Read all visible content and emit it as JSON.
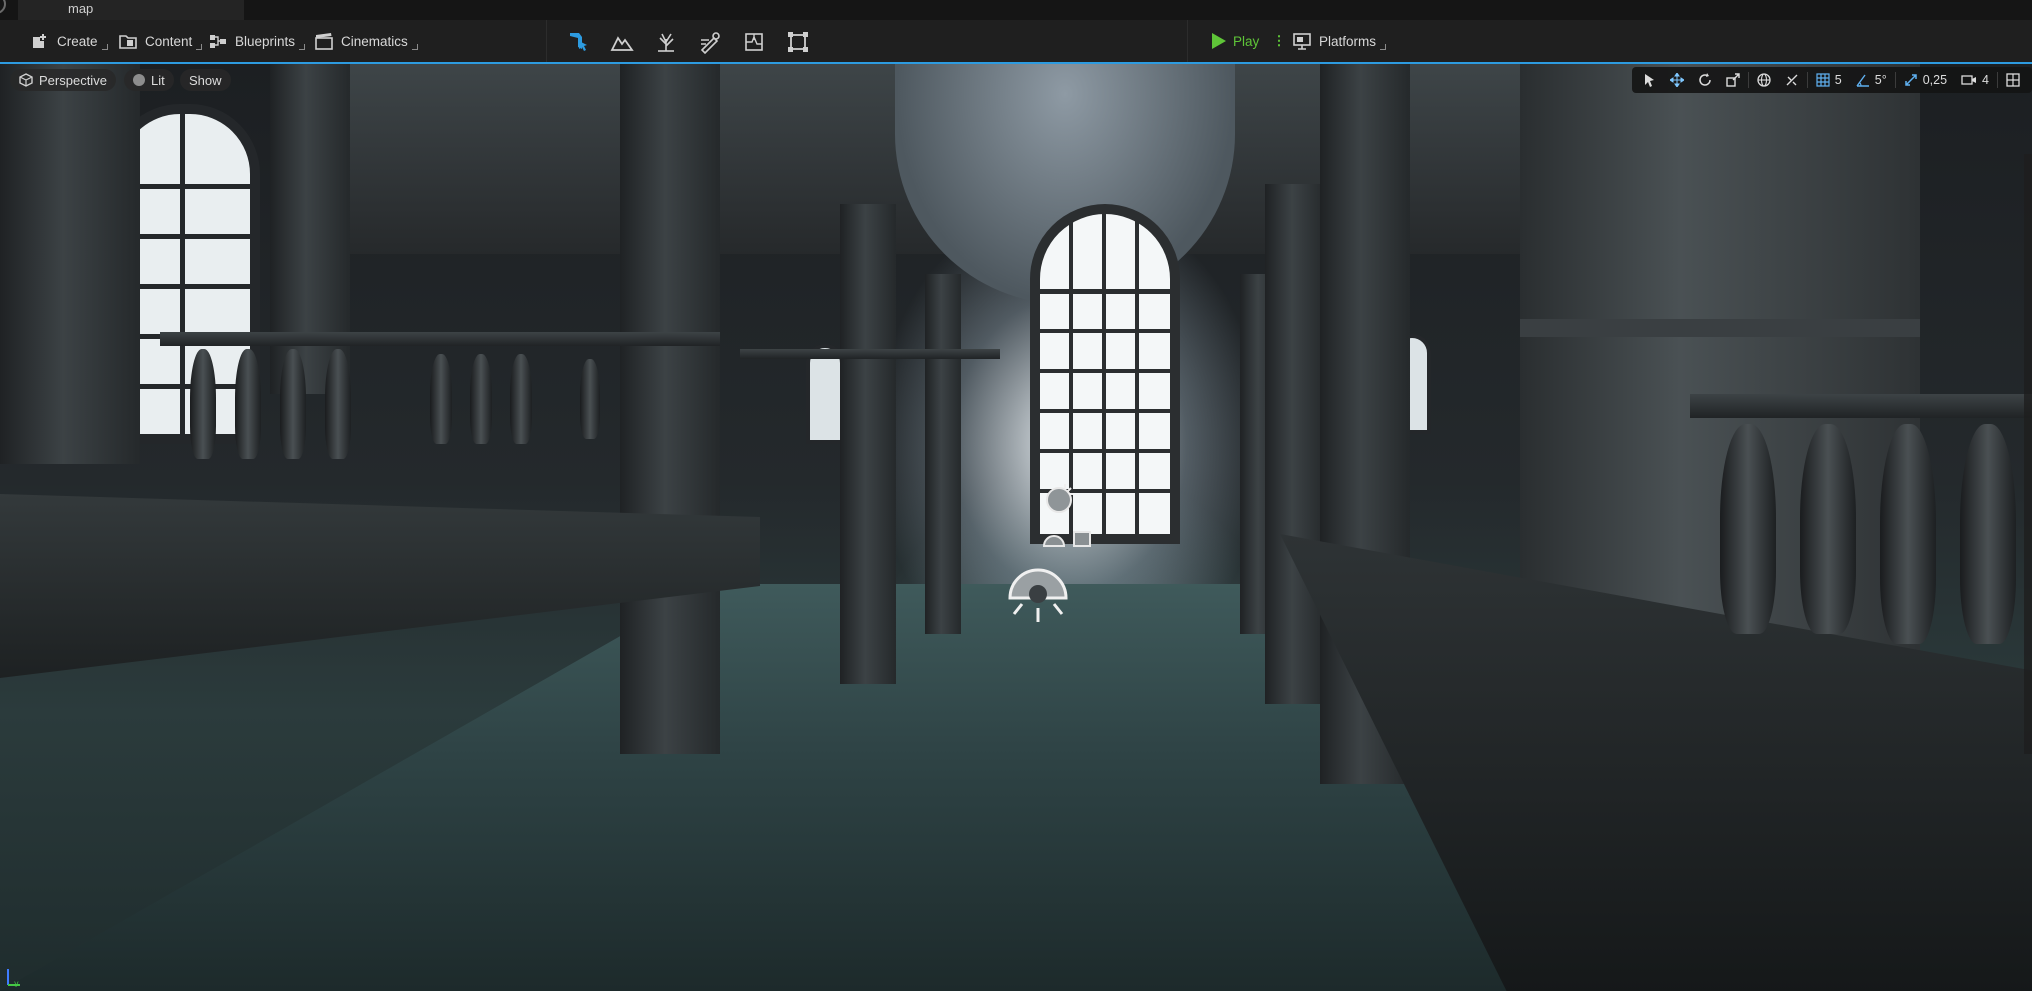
{
  "tab": {
    "title": "map"
  },
  "toolbar": {
    "create": "Create",
    "content": "Content",
    "blueprints": "Blueprints",
    "cinematics": "Cinematics",
    "play": "Play",
    "platforms": "Platforms",
    "accent_color": "#2d9be0",
    "play_color": "#5fc538",
    "mode_icons": [
      "select-mode-icon",
      "landscape-mode-icon",
      "foliage-mode-icon",
      "mesh-paint-mode-icon",
      "fracture-mode-icon",
      "modeling-mode-icon"
    ]
  },
  "viewport": {
    "perspective": "Perspective",
    "lit": "Lit",
    "show": "Show",
    "grid_snap": "5",
    "angle_snap": "5°",
    "scale_snap": "0,25",
    "camera_speed": "4"
  }
}
